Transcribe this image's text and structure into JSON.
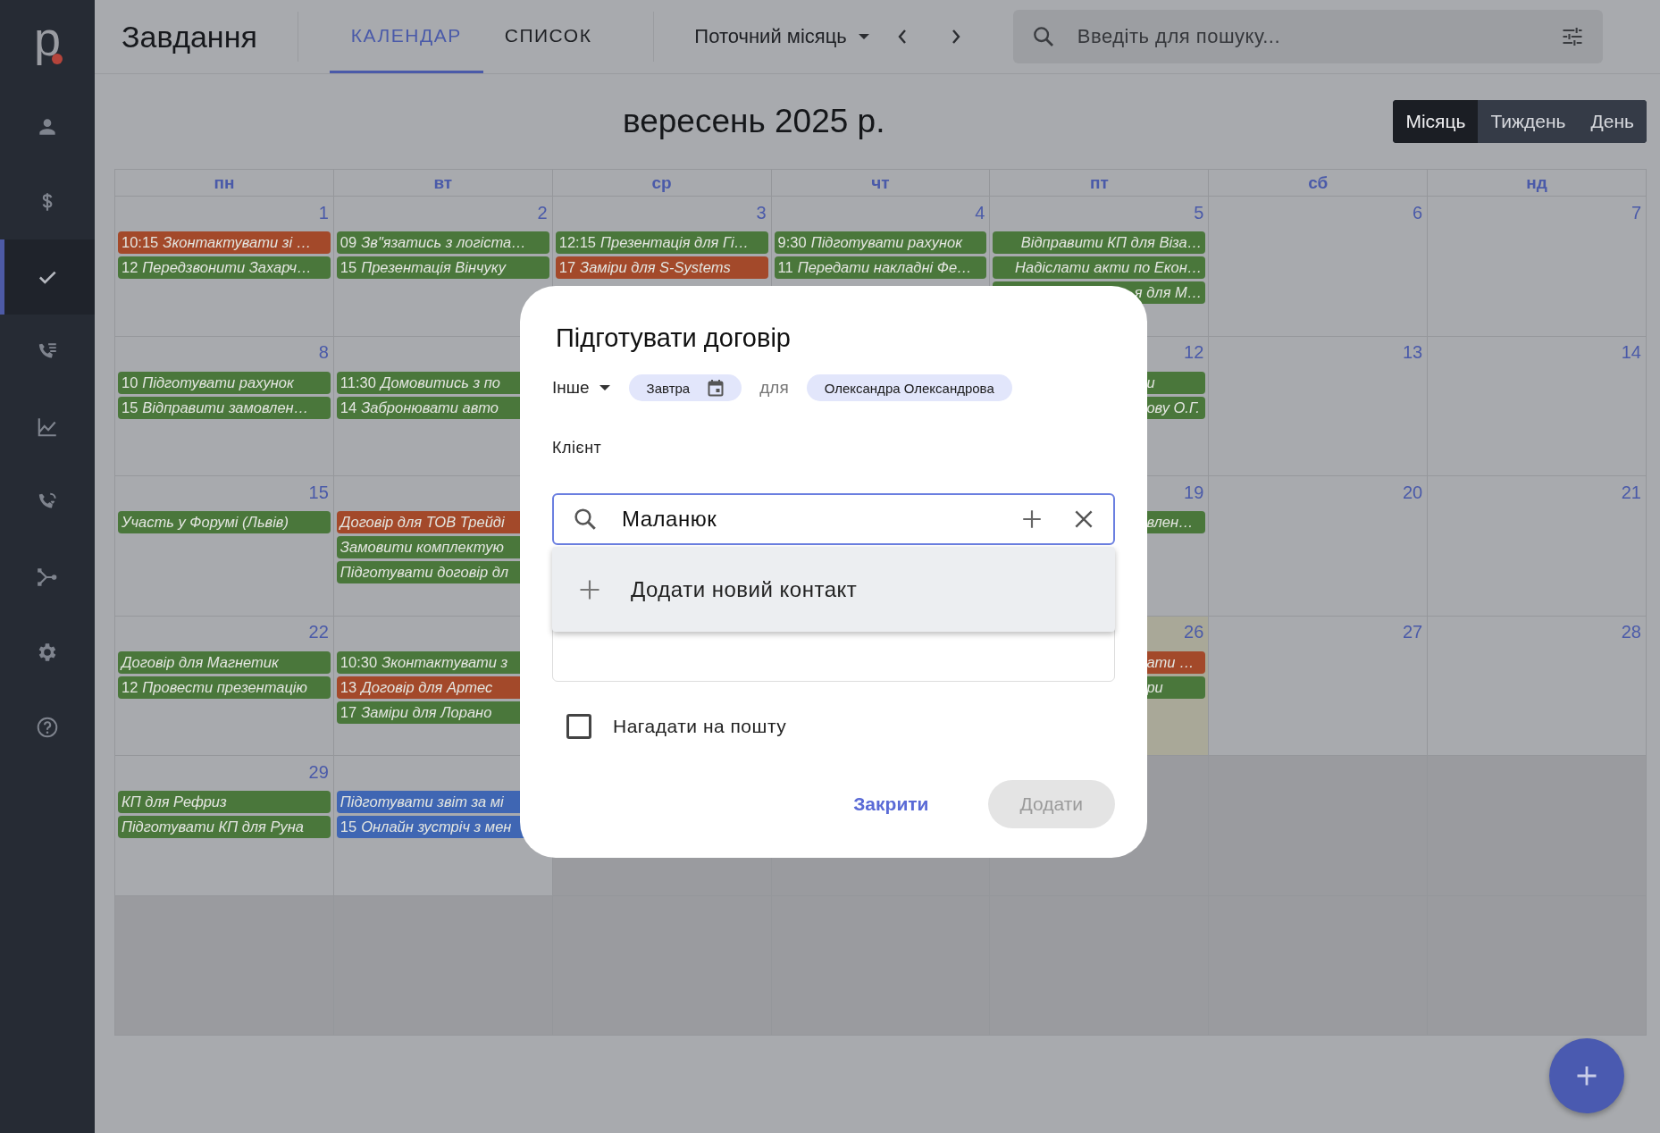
{
  "sidebar": {
    "logo": "p",
    "items": [
      {
        "selected": false
      },
      {
        "selected": false
      },
      {
        "selected": true
      },
      {
        "selected": false
      },
      {
        "selected": false
      },
      {
        "selected": false
      },
      {
        "selected": false
      },
      {
        "selected": false
      },
      {
        "selected": false
      }
    ]
  },
  "top_bar": {
    "title": "Завдання",
    "tabs": [
      {
        "label": "КАЛЕНДАР",
        "selected": true
      },
      {
        "label": "СПИСОК",
        "selected": false
      }
    ],
    "period": "Поточний місяць",
    "search": {
      "placeholder": "Введіть для пошуку..."
    }
  },
  "calendar": {
    "month_title": "вересень 2025 р.",
    "views": [
      {
        "label": "Місяць",
        "selected": true
      },
      {
        "label": "Тиждень",
        "selected": false
      },
      {
        "label": "День",
        "selected": false
      }
    ],
    "weekdays": [
      "пн",
      "вт",
      "ср",
      "чт",
      "пт",
      "сб",
      "нд"
    ],
    "weeks": [
      {
        "days": [
          {
            "day": "1",
            "out_of_month": false,
            "today": false,
            "events": [
              {
                "time": "10:15",
                "title": "Зконтактувати зі …",
                "color": "#a3492a"
              },
              {
                "time": "12",
                "title": "Передзвонити Захарч…",
                "color": "#4a773b"
              }
            ]
          },
          {
            "day": "2",
            "out_of_month": false,
            "today": false,
            "events": [
              {
                "time": "09",
                "title": "Зв\"язатись з логіста…",
                "color": "#4a773b"
              },
              {
                "time": "15",
                "title": "Презентація Вінчуку",
                "color": "#4a773b"
              }
            ]
          },
          {
            "day": "3",
            "out_of_month": false,
            "today": false,
            "events": [
              {
                "time": "12:15",
                "title": "Презентація для Гі…",
                "color": "#4a773b"
              },
              {
                "time": "17",
                "title": "Заміри для S-Systems",
                "color": "#a3492a"
              }
            ]
          },
          {
            "day": "4",
            "out_of_month": false,
            "today": false,
            "events": [
              {
                "time": "9:30",
                "title": "Підготувати рахунок",
                "color": "#4a773b"
              },
              {
                "time": "11",
                "title": "Передати накладні Фе…",
                "color": "#4a773b"
              }
            ]
          },
          {
            "day": "5",
            "out_of_month": false,
            "today": false,
            "events": [
              {
                "title": "Відправити КП для Віза…",
                "color": "#4a773b"
              },
              {
                "title": "Надіслати акти по Екон…",
                "color": "#4a773b"
              },
              {
                "title": "я для М…",
                "color": "#4a773b"
              }
            ]
          },
          {
            "day": "6",
            "out_of_month": false,
            "today": false
          },
          {
            "day": "7",
            "out_of_month": false,
            "today": false
          }
        ]
      },
      {
        "days": [
          {
            "day": "8",
            "out_of_month": false,
            "today": false,
            "events": [
              {
                "time": "10",
                "title": "Підготувати рахунок",
                "color": "#4a773b"
              },
              {
                "time": "15",
                "title": "Відправити замовлен…",
                "color": "#4a773b"
              }
            ]
          },
          {
            "out_of_month": false,
            "today": false,
            "events": [
              {
                "time": "11:30",
                "title": "Домовитись з по",
                "color": "#4a773b"
              },
              {
                "time": "14",
                "title": "Забронювати авто",
                "color": "#4a773b"
              }
            ]
          }
        ],
        "end_days": [
          {
            "day": "12",
            "out_of_month": false,
            "today": false,
            "events": [
              {
                "title": "и",
                "color": "#4a773b"
              },
              {
                "title": "ову О.Г.",
                "color": "#4a773b"
              }
            ]
          },
          {
            "day": "13",
            "out_of_month": false,
            "today": false
          },
          {
            "day": "14",
            "out_of_month": false,
            "today": false
          }
        ]
      },
      {
        "days": [
          {
            "day": "15",
            "out_of_month": false,
            "today": false,
            "events": [
              {
                "title": "Участь у Форумі (Львів)",
                "color": "#4a773b"
              }
            ]
          },
          {
            "out_of_month": false,
            "today": false,
            "events": [
              {
                "title": "Договір для ТОВ Трейді",
                "color": "#a3492a"
              },
              {
                "title": "Замовити комплектую",
                "color": "#4a773b"
              },
              {
                "title": "Підготувати договір дл",
                "color": "#4a773b"
              }
            ]
          }
        ],
        "end_days": [
          {
            "day": "19",
            "out_of_month": false,
            "today": false,
            "events": [
              {
                "title": "влен…",
                "color": "#4a773b"
              }
            ]
          },
          {
            "day": "20",
            "out_of_month": false,
            "today": false
          },
          {
            "day": "21",
            "out_of_month": false,
            "today": false
          }
        ]
      },
      {
        "days": [
          {
            "day": "22",
            "out_of_month": false,
            "today": false,
            "events": [
              {
                "title": "Договір для Магнетик",
                "color": "#4a773b"
              },
              {
                "time": "12",
                "title": "Провести презентацію",
                "color": "#4a773b"
              }
            ]
          },
          {
            "out_of_month": false,
            "today": false,
            "events": [
              {
                "time": "10:30",
                "title": "Зконтактувати з",
                "color": "#4a773b"
              },
              {
                "time": "13",
                "title": "Договір для Артес",
                "color": "#a3492a"
              },
              {
                "time": "17",
                "title": "Заміри для Лорано",
                "color": "#4a773b"
              }
            ]
          }
        ],
        "end_days": [
          {
            "day": "26",
            "out_of_month": false,
            "today": true,
            "events": [
              {
                "title": "ати …",
                "color": "#a3492a"
              },
              {
                "title": "ри",
                "color": "#4a773b"
              }
            ]
          },
          {
            "day": "27",
            "out_of_month": false,
            "today": false
          },
          {
            "day": "28",
            "out_of_month": false,
            "today": false
          }
        ]
      },
      {
        "days": [
          {
            "day": "29",
            "out_of_month": false,
            "today": false,
            "events": [
              {
                "title": "КП для Рефриз",
                "color": "#4a773b"
              },
              {
                "title": "Підготувати КП для Руна",
                "color": "#4a773b"
              }
            ]
          },
          {
            "out_of_month": false,
            "today": false,
            "events": [
              {
                "title": "Підготувати звіт за мі",
                "color": "#3f66b3"
              },
              {
                "time": "15",
                "title": "Онлайн зустріч з мен",
                "color": "#3f66b3"
              }
            ]
          },
          {
            "out_of_month": true,
            "today": false
          },
          {
            "out_of_month": true,
            "today": false
          },
          {
            "out_of_month": true,
            "today": false
          },
          {
            "out_of_month": true,
            "today": false
          },
          {
            "out_of_month": true,
            "today": false
          }
        ]
      },
      {
        "days": [
          {
            "out_of_month": true,
            "today": false
          },
          {
            "out_of_month": true,
            "today": false
          },
          {
            "out_of_month": true,
            "today": false
          },
          {
            "out_of_month": true,
            "today": false
          },
          {
            "out_of_month": true,
            "today": false
          },
          {
            "out_of_month": true,
            "today": false
          },
          {
            "out_of_month": true,
            "today": false
          }
        ]
      }
    ]
  },
  "dialog": {
    "title": "Підготувати договір",
    "type": "Інше",
    "date_chip": "Завтра",
    "for_label": "для",
    "assignee_chip": "Олександра Олександрова",
    "client_label": "Клієнт",
    "client_field": {
      "value": "Маланюк"
    },
    "suggestions": [
      {
        "label": "Додати новий контакт"
      }
    ],
    "reminder": {
      "label": "Нагадати на пошту",
      "checked": false
    },
    "buttons": [
      {
        "label": "Закрити",
        "kind": "text",
        "disabled": false
      },
      {
        "label": "Додати",
        "kind": "filled",
        "disabled": true
      }
    ]
  }
}
